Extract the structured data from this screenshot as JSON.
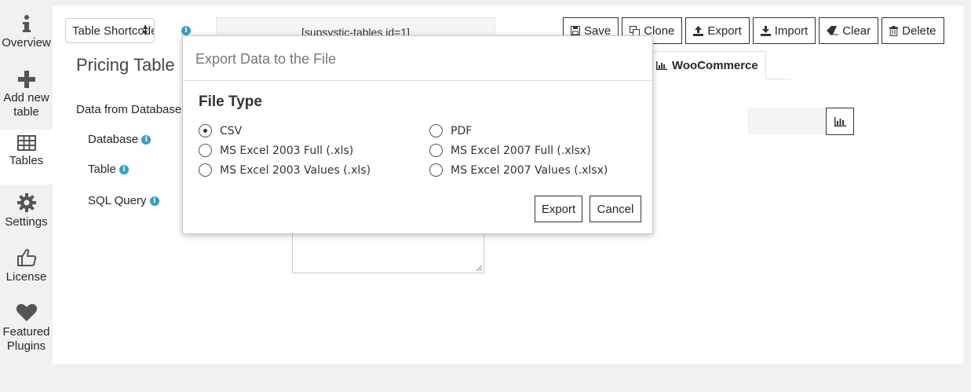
{
  "sidebar": {
    "items": [
      {
        "label": "Overview",
        "icon": "info-icon"
      },
      {
        "label": "Add new\ntable",
        "icon": "plus-icon"
      },
      {
        "label": "Tables",
        "icon": "table-grid-icon",
        "active": true
      },
      {
        "label": "Settings",
        "icon": "gear-icon"
      },
      {
        "label": "License",
        "icon": "thumbs-up-icon"
      },
      {
        "label": "Featured\nPlugins",
        "icon": "heart-icon"
      }
    ]
  },
  "header": {
    "shortcode_select_value": "Table Shortcode",
    "shortcode_text": "[supsystic-tables id=1]",
    "page_title": "Pricing Table"
  },
  "toolbar": {
    "save": "Save",
    "clone": "Clone",
    "export": "Export",
    "import": "Import",
    "clear": "Clear",
    "delete": "Delete"
  },
  "tabs": {
    "woocommerce": "WooCommerce"
  },
  "form": {
    "data_from_database": "Data from Database",
    "database": "Database",
    "table": "Table",
    "sql_query": "SQL Query"
  },
  "modal": {
    "title": "Export Data to the File",
    "heading": "File Type",
    "options": [
      {
        "label": "CSV",
        "checked": true
      },
      {
        "label": "PDF",
        "checked": false
      },
      {
        "label": "MS Excel 2003 Full (.xls)",
        "checked": false
      },
      {
        "label": "MS Excel 2007 Full (.xlsx)",
        "checked": false
      },
      {
        "label": "MS Excel 2003 Values (.xls)",
        "checked": false
      },
      {
        "label": "MS Excel 2007 Values (.xlsx)",
        "checked": false
      }
    ],
    "export_button": "Export",
    "cancel_button": "Cancel"
  },
  "colors": {
    "info_blue": "#2ea2cc",
    "sidebar_bg": "#f1f1f1",
    "panel_bg": "#ffffff"
  }
}
